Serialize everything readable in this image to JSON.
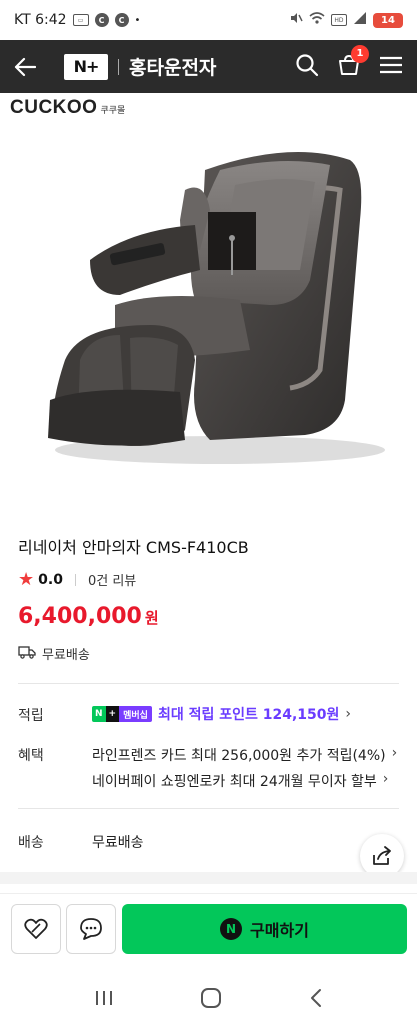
{
  "status_bar": {
    "carrier_time": "KT 6:42",
    "battery": "14"
  },
  "header": {
    "logo_text": "N+",
    "title": "홍타운전자",
    "cart_count": "1"
  },
  "brand": {
    "logo": "CUCKOO",
    "sub": "쿠쿠몰"
  },
  "product": {
    "name": "리네이처 안마의자 CMS-F410CB",
    "rating": "0.0",
    "reviews": "0건 리뷰",
    "price": "6,400,000",
    "currency": "원",
    "shipping_tag": "무료배송"
  },
  "details": {
    "points_label": "적립",
    "points_badge_n": "N",
    "points_badge_plus": "+",
    "points_badge_member": "멤버십",
    "points_text": "최대 적립 포인트 124,150원",
    "benefits_label": "혜택",
    "benefit_1": "라인프렌즈 카드 최대 256,000원 추가 적립(4%)",
    "benefit_2": "네이버페이 쇼핑엔로카 최대 24개월 무이자 할부",
    "delivery_label": "배송",
    "delivery_value": "무료배송"
  },
  "actions": {
    "buy_label": "구매하기",
    "buy_icon": "N"
  },
  "colors": {
    "price": "#e8192c",
    "buy": "#03c75a",
    "points": "#6a3cff"
  }
}
